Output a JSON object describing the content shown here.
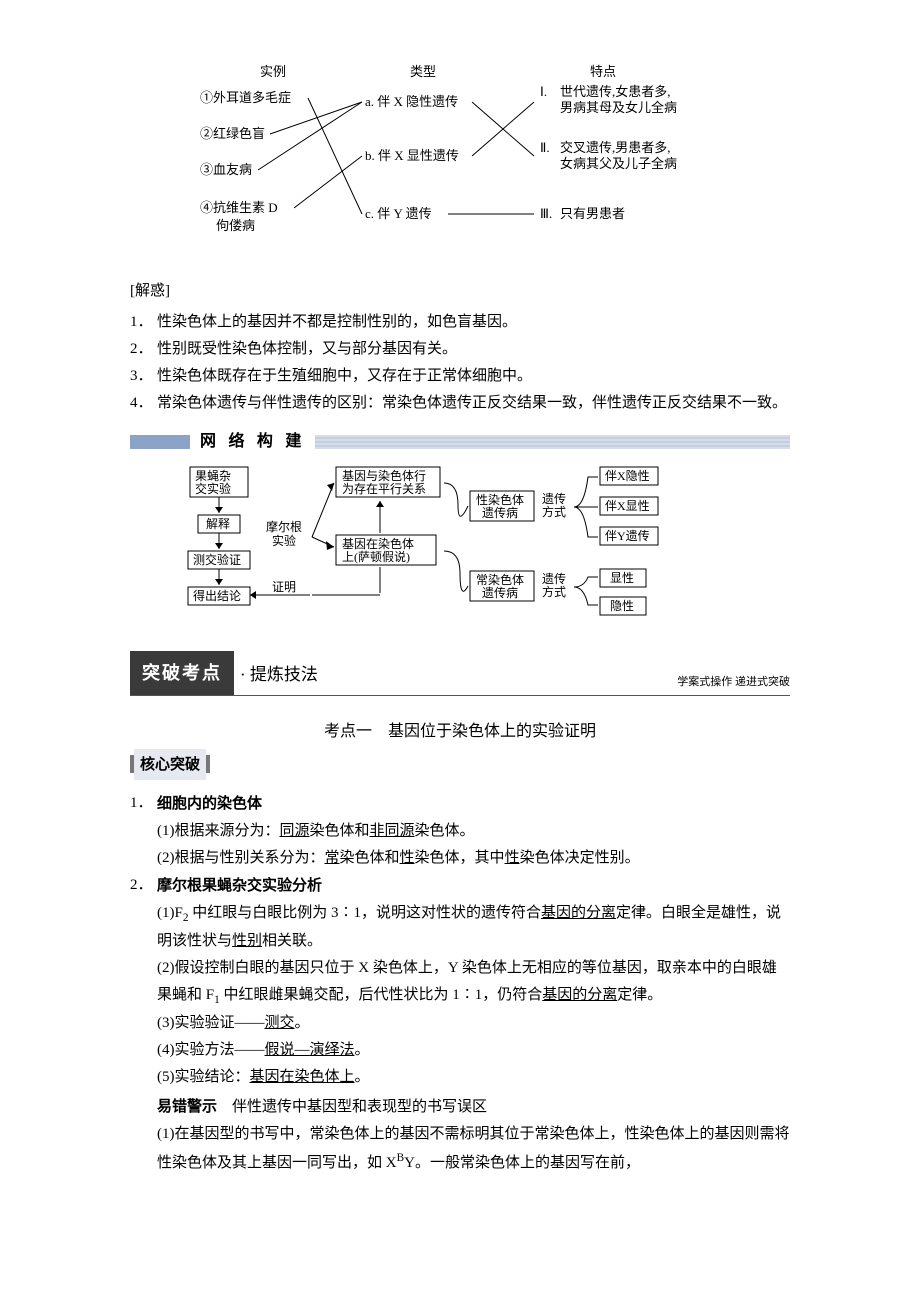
{
  "diagram1": {
    "headers": [
      "实例",
      "类型",
      "特点"
    ],
    "examples": [
      "①外耳道多毛症",
      "②红绿色盲",
      "③血友病",
      "④抗维生素 D",
      "佝偻病"
    ],
    "types": [
      "a. 伴 X 隐性遗传",
      "b. 伴 X 显性遗传",
      "c. 伴 Y 遗传"
    ],
    "features_prefix": [
      "Ⅰ.",
      "Ⅱ.",
      "Ⅲ."
    ],
    "features": [
      "世代遗传,女患者多,\n男病其母及女儿全病",
      "交叉遗传,男患者多,\n女病其父及儿子全病",
      "只有男患者"
    ]
  },
  "jiehu": "[解惑]",
  "jiehu_items": [
    "性染色体上的基因并不都是控制性别的，如色盲基因。",
    "性别既受性染色体控制，又与部分基因有关。",
    "性染色体既存在于生殖细胞中，又存在于正常体细胞中。",
    "常染色体遗传与伴性遗传的区别：常染色体遗传正反交结果一致，伴性遗传正反交结果不一致。"
  ],
  "net_title": "网 络 构 建",
  "diagram2": {
    "left_chain": [
      "果蝇杂",
      "交实验",
      "解释",
      "测交验证",
      "得出结论"
    ],
    "morgan": "摩尔根实验",
    "center_top": [
      "基因与染色体行",
      "为存在平行关系"
    ],
    "center_bot": [
      "基因在染色体",
      "上(萨顿假说)"
    ],
    "zhengming": "证明",
    "right_top_box": [
      "性染色体",
      "遗传病"
    ],
    "right_bot_box": [
      "常染色体",
      "遗传病"
    ],
    "mode_label": [
      "遗传",
      "方式"
    ],
    "rboxes_top": [
      "伴X隐性",
      "伴X显性",
      "伴Y遗传"
    ],
    "rboxes_bot": [
      "显性",
      "隐性"
    ]
  },
  "dark_title": "突破考点",
  "dark_sub": "· 提炼技法",
  "dark_right": "学案式操作  递进式突破",
  "kaodian": "考点一　基因位于染色体上的实验证明",
  "hxtp": "核心突破",
  "point1_title": "细胞内的染色体",
  "point1_1a": "(1)根据来源分为：",
  "point1_1b": "同源",
  "point1_1c": "染色体和",
  "point1_1d": "非同源",
  "point1_1e": "染色体。",
  "point1_2a": "(2)根据与性别关系分为：",
  "point1_2b": "常",
  "point1_2c": "染色体和",
  "point1_2d": "性",
  "point1_2e": "染色体，其中",
  "point1_2f": "性",
  "point1_2g": "染色体决定性别。",
  "point2_title": "摩尔根果蝇杂交实验分析",
  "p2_1a": "(1)F",
  "p2_1b": " 中红眼与白眼比例为 3∶1，说明这对性状的遗传符合",
  "p2_1c": "基因的分离",
  "p2_1d": "定律。白眼全是雄性，说明该性状与",
  "p2_1e": "性别",
  "p2_1f": "相关联。",
  "p2_2a": "(2)假设控制白眼的基因只位于 X 染色体上，Y 染色体上无相应的等位基因，取亲本中的白眼雄果蝇和 F",
  "p2_2b": " 中红眼雌果蝇交配，后代性状比为 1∶1，仍符合",
  "p2_2c": "基因的分离",
  "p2_2d": "定律。",
  "p2_3a": "(3)实验验证——",
  "p2_3b": "测交",
  "p2_3dot": "。",
  "p2_4a": "(4)实验方法——",
  "p2_4b": "假说—演绎法",
  "p2_5a": "(5)实验结论：",
  "p2_5b": "基因在染色体上",
  "yicuo_label": "易错警示",
  "yicuo_title": "　伴性遗传中基因型和表现型的书写误区",
  "yc_1a": "(1)在基因型的书写中，常染色体上的基因不需标明其位于常染色体上，性染色体上的基因则需将性染色体及其上基因一同写出，如 X",
  "yc_1b": "B",
  "yc_1c": "Y。一般常染色体上的基因写在前，"
}
